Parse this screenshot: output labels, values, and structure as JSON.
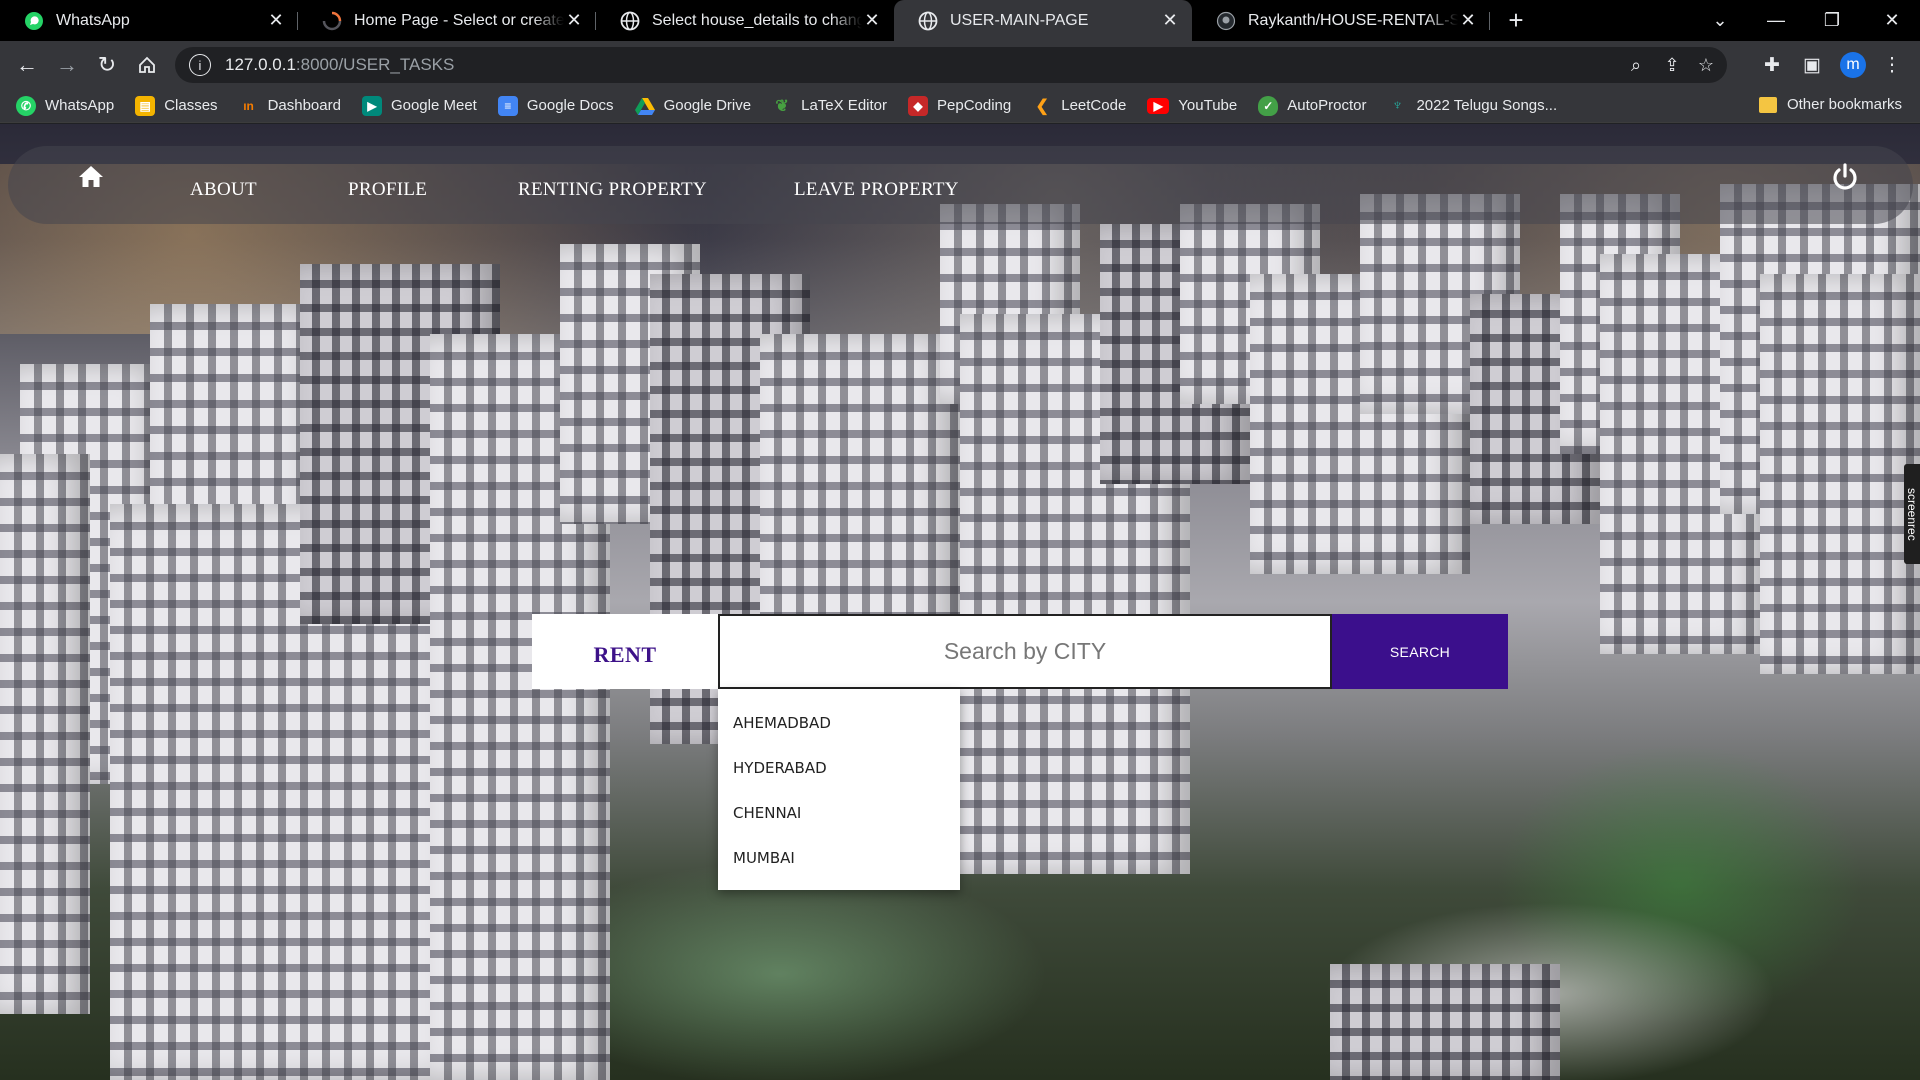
{
  "browser": {
    "tabs": [
      {
        "title": "WhatsApp",
        "icon": "whatsapp-icon",
        "active": false
      },
      {
        "title": "Home Page - Select or create a n",
        "icon": "loading-spinner-icon",
        "active": false
      },
      {
        "title": "Select house_details to change | D",
        "icon": "globe-icon",
        "active": false
      },
      {
        "title": "USER-MAIN-PAGE",
        "icon": "globe-icon",
        "active": true
      },
      {
        "title": "Raykanth/HOUSE-RENTAL-SYSTE",
        "icon": "github-icon",
        "active": false
      }
    ],
    "address": {
      "host": "127.0.0.1",
      "path": ":8000/USER_TASKS"
    },
    "profile_initial": "m",
    "bookmarks": [
      {
        "label": "WhatsApp",
        "icon": "whatsapp-icon",
        "color": "#25d366"
      },
      {
        "label": "Classes",
        "icon": "classroom-icon",
        "color": "#f4b400"
      },
      {
        "label": "Dashboard",
        "icon": "dashboard-icon",
        "color": "#f57c00"
      },
      {
        "label": "Google Meet",
        "icon": "meet-icon",
        "color": "#00897b"
      },
      {
        "label": "Google Docs",
        "icon": "docs-icon",
        "color": "#4285f4"
      },
      {
        "label": "Google Drive",
        "icon": "drive-icon",
        "color": "#fbbc04"
      },
      {
        "label": "LaTeX Editor",
        "icon": "overleaf-icon",
        "color": "#47a141"
      },
      {
        "label": "PepCoding",
        "icon": "pepcoding-icon",
        "color": "#c62828"
      },
      {
        "label": "LeetCode",
        "icon": "leetcode-icon",
        "color": "#ffa116"
      },
      {
        "label": "YouTube",
        "icon": "youtube-icon",
        "color": "#ff0000"
      },
      {
        "label": "AutoProctor",
        "icon": "autoproctor-icon",
        "color": "#43a047"
      },
      {
        "label": "2022 Telugu Songs...",
        "icon": "music-icon",
        "color": "#26a69a"
      }
    ],
    "other_bookmarks": "Other bookmarks"
  },
  "page": {
    "nav": {
      "home_icon": "home-icon",
      "links": [
        "ABOUT",
        "PROFILE",
        "RENTING PROPERTY",
        "LEAVE PROPERTY"
      ],
      "logout_icon": "power-icon"
    },
    "search": {
      "mode_label": "RENT",
      "placeholder": "Search by CITY",
      "button_label": "SEARCH",
      "suggestions": [
        "AHEMADBAD",
        "HYDERABAD",
        "CHENNAI",
        "MUMBAI"
      ]
    },
    "recorder_badge": "screenrec"
  },
  "colors": {
    "accent": "#3b0f8c",
    "rent_text": "#3d1289"
  }
}
